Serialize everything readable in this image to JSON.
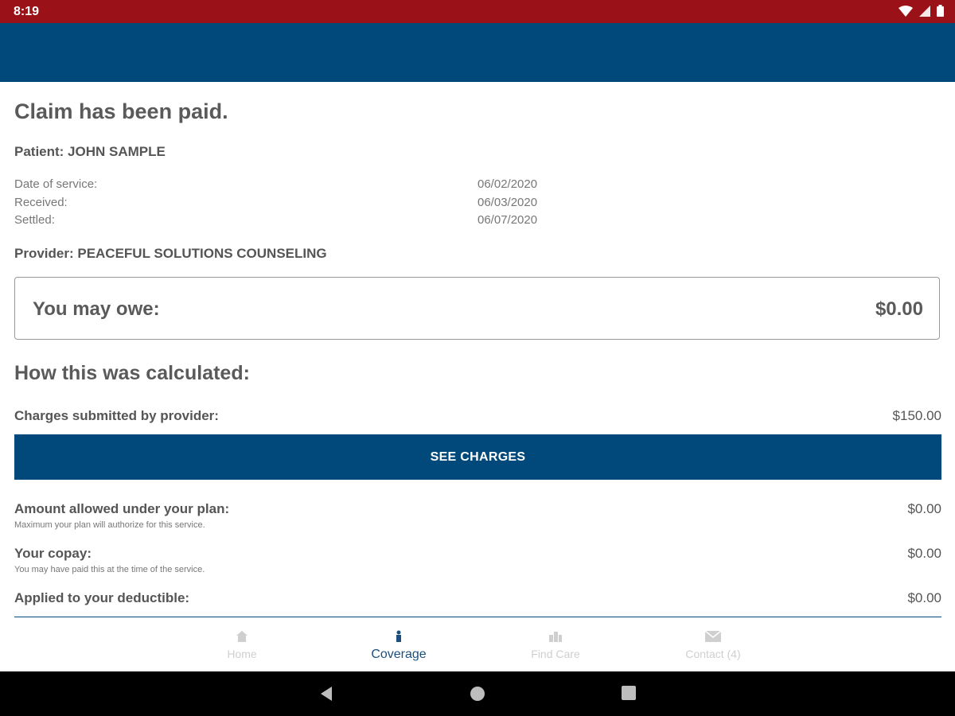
{
  "status_bar": {
    "time": "8:19",
    "icons": [
      "wifi-icon",
      "signal-icon",
      "battery-icon"
    ]
  },
  "claim": {
    "title": "Claim has been paid.",
    "patient": "Patient: JOHN SAMPLE",
    "dates": [
      {
        "label": "Date of service:",
        "value": "06/02/2020"
      },
      {
        "label": "Received:",
        "value": "06/03/2020"
      },
      {
        "label": "Settled:",
        "value": "06/07/2020"
      }
    ],
    "provider": "Provider: PEACEFUL SOLUTIONS COUNSELING",
    "owe": {
      "label": "You may owe:",
      "value": "$0.00"
    }
  },
  "calculation": {
    "heading": "How this was calculated:",
    "charges": {
      "label": "Charges submitted by provider:",
      "value": "$150.00"
    },
    "see_charges_label": "SEE CHARGES",
    "allowed": {
      "label": "Amount allowed under your plan:",
      "sub": "Maximum your plan will authorize for this service.",
      "value": "$0.00"
    },
    "copay": {
      "label": "Your copay:",
      "sub": "You may have paid this at the time of the service.",
      "value": "$0.00"
    },
    "deductible": {
      "label": "Applied to your deductible:",
      "value": "$0.00"
    }
  },
  "bottom_nav": [
    {
      "label": "Home",
      "icon": "home-icon",
      "active": false
    },
    {
      "label": "Coverage",
      "icon": "coverage-icon",
      "active": true
    },
    {
      "label": "Find Care",
      "icon": "find-care-icon",
      "active": false
    },
    {
      "label": "Contact (4)",
      "icon": "mail-icon",
      "active": false
    }
  ],
  "colors": {
    "status_bar": "#9b1118",
    "app_bar": "#02497b",
    "primary_button": "#02497b",
    "active_nav": "#1b4f7f",
    "inactive_nav": "#cfcfcf"
  }
}
